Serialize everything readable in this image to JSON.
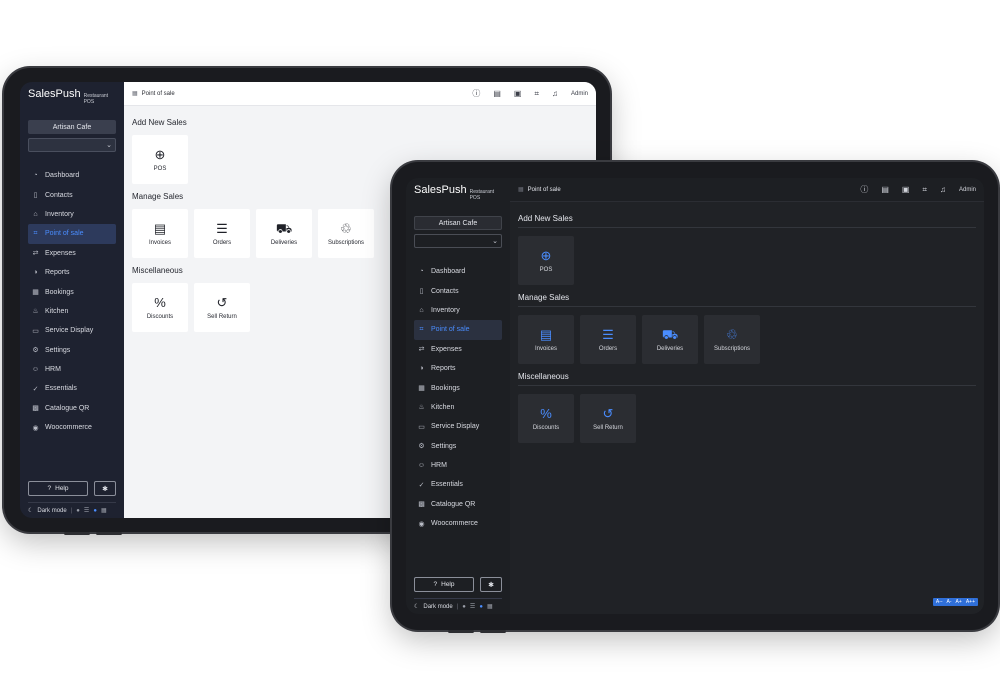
{
  "brand": {
    "name": "SalesPush",
    "sub": "Restaurant POS"
  },
  "store": {
    "name": "Artisan Cafe",
    "select_chevron": "⌄"
  },
  "nav": [
    {
      "label": "Dashboard",
      "icon": "dashboard-icon"
    },
    {
      "label": "Contacts",
      "icon": "contacts-icon"
    },
    {
      "label": "Inventory",
      "icon": "inventory-icon"
    },
    {
      "label": "Point of sale",
      "icon": "point-of-sale-icon",
      "active": true
    },
    {
      "label": "Expenses",
      "icon": "expenses-icon"
    },
    {
      "label": "Reports",
      "icon": "reports-icon"
    },
    {
      "label": "Bookings",
      "icon": "bookings-icon"
    },
    {
      "label": "Kitchen",
      "icon": "kitchen-icon"
    },
    {
      "label": "Service Display",
      "icon": "service-display-icon"
    },
    {
      "label": "Settings",
      "icon": "settings-icon"
    },
    {
      "label": "HRM",
      "icon": "hrm-icon"
    },
    {
      "label": "Essentials",
      "icon": "essentials-icon"
    },
    {
      "label": "Catalogue QR",
      "icon": "catalogue-qr-icon"
    },
    {
      "label": "Woocommerce",
      "icon": "woocommerce-icon"
    }
  ],
  "help_label": "Help",
  "dark_mode_label": "Dark mode",
  "breadcrumb": "Point of sale",
  "admin_label": "Admin",
  "sections": {
    "add_new_sales": "Add New Sales",
    "manage_sales": "Manage Sales",
    "miscellaneous": "Miscellaneous"
  },
  "cards": {
    "pos": "POS",
    "invoices": "Invoices",
    "orders": "Orders",
    "deliveries": "Deliveries",
    "subscriptions": "Subscriptions",
    "discounts": "Discounts",
    "sell_return": "Sell Return"
  },
  "font_size_controls": [
    "A--",
    "A-",
    "A+",
    "A++"
  ],
  "colors": {
    "accent": "#4a8dff",
    "sidebar": "#1e2230",
    "dark_main": "#202226"
  }
}
